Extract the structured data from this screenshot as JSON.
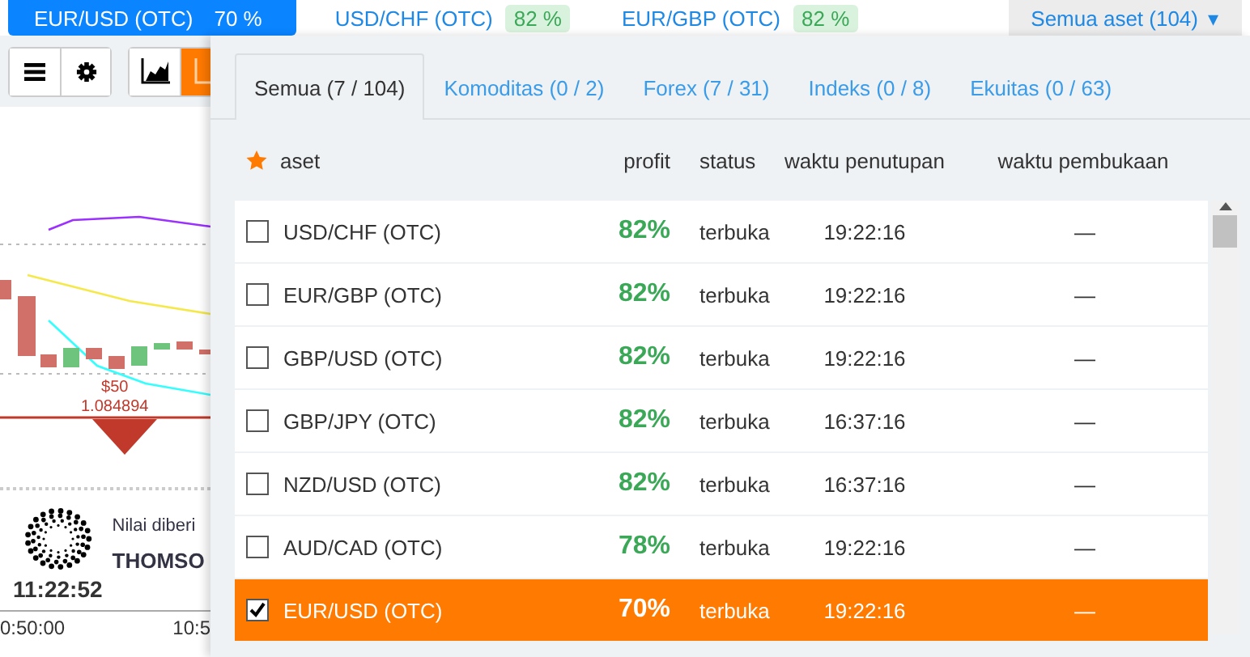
{
  "top_tabs": [
    {
      "label": "EUR/USD (OTC)",
      "badge": "70 %",
      "selected": true
    },
    {
      "label": "USD/CHF (OTC)",
      "badge": "82 %",
      "selected": false
    },
    {
      "label": "EUR/GBP (OTC)",
      "badge": "82 %",
      "selected": false
    }
  ],
  "asset_dropdown": {
    "label": "Semua aset (104)",
    "caret": "▾"
  },
  "chart": {
    "price_label": "$50",
    "price_value": "1.084894",
    "provider_text": "Nilai diberi",
    "provider_name": "THOMSO",
    "clock": "11:22:52",
    "time_axis": [
      "0:50:00",
      "10:5"
    ]
  },
  "panel": {
    "tabs": [
      {
        "label": "Semua (7 / 104)",
        "selected": true
      },
      {
        "label": "Komoditas (0 / 2)",
        "selected": false
      },
      {
        "label": "Forex (7 / 31)",
        "selected": false
      },
      {
        "label": "Indeks (0 / 8)",
        "selected": false
      },
      {
        "label": "Ekuitas (0 / 63)",
        "selected": false
      }
    ],
    "columns": [
      "aset",
      "profit",
      "status",
      "waktu penutupan",
      "waktu pembukaan"
    ],
    "rows": [
      {
        "asset": "USD/CHF (OTC)",
        "checked": false,
        "selected": false,
        "profit": "82%",
        "status": "terbuka",
        "close": "19:22:16",
        "open": "—"
      },
      {
        "asset": "EUR/GBP (OTC)",
        "checked": false,
        "selected": false,
        "profit": "82%",
        "status": "terbuka",
        "close": "19:22:16",
        "open": "—"
      },
      {
        "asset": "GBP/USD (OTC)",
        "checked": false,
        "selected": false,
        "profit": "82%",
        "status": "terbuka",
        "close": "19:22:16",
        "open": "—"
      },
      {
        "asset": "GBP/JPY (OTC)",
        "checked": false,
        "selected": false,
        "profit": "82%",
        "status": "terbuka",
        "close": "16:37:16",
        "open": "—"
      },
      {
        "asset": "NZD/USD (OTC)",
        "checked": false,
        "selected": false,
        "profit": "82%",
        "status": "terbuka",
        "close": "16:37:16",
        "open": "—"
      },
      {
        "asset": "AUD/CAD (OTC)",
        "checked": false,
        "selected": false,
        "profit": "78%",
        "status": "terbuka",
        "close": "19:22:16",
        "open": "—"
      },
      {
        "asset": "EUR/USD (OTC)",
        "checked": true,
        "selected": true,
        "profit": "70%",
        "status": "terbuka",
        "close": "19:22:16",
        "open": "—"
      }
    ]
  }
}
